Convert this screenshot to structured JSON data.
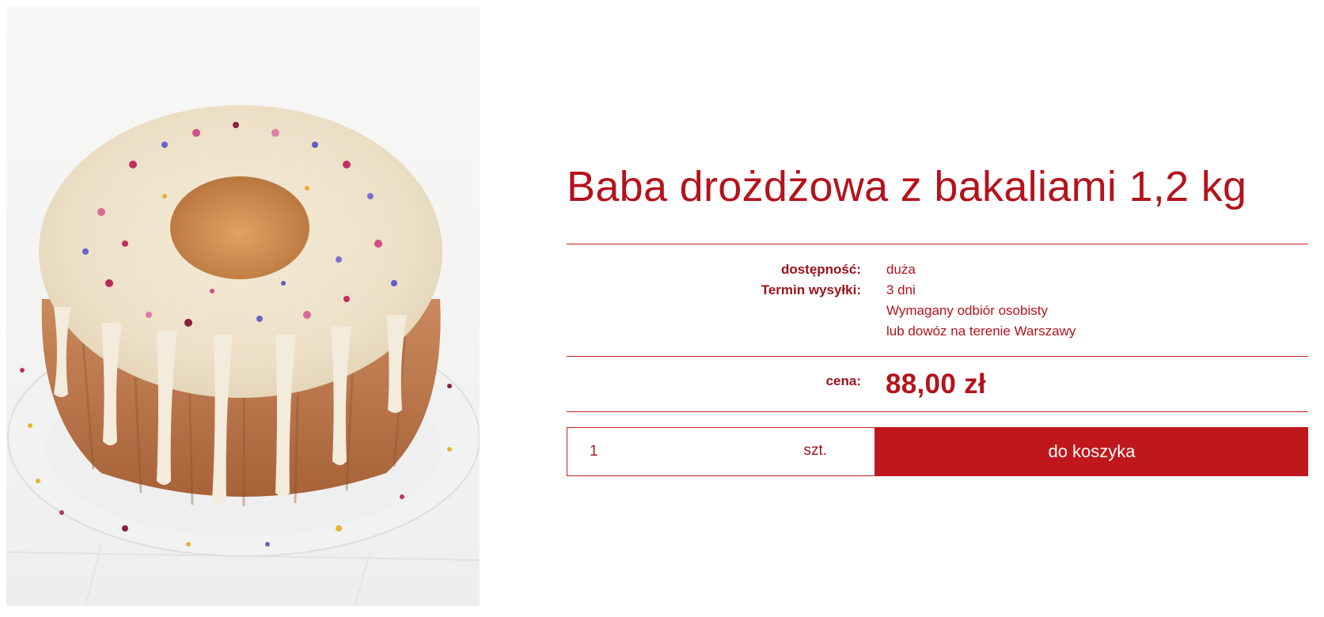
{
  "product": {
    "title": "Baba drożdżowa z bakaliami 1,2 kg",
    "availability_label": "dostępność:",
    "availability_value": "duża",
    "shipping_label": "Termin wysyłki:",
    "shipping_lines": [
      "3 dni",
      "Wymagany odbiór osobisty",
      "lub dowóz na terenie Warszawy"
    ],
    "price_label": "cena:",
    "price_value": "88,00 zł"
  },
  "cart": {
    "quantity": "1",
    "unit": "szt.",
    "button_label": "do koszyka"
  },
  "colors": {
    "brand_red": "#c0171c",
    "text_red": "#b5121b"
  }
}
